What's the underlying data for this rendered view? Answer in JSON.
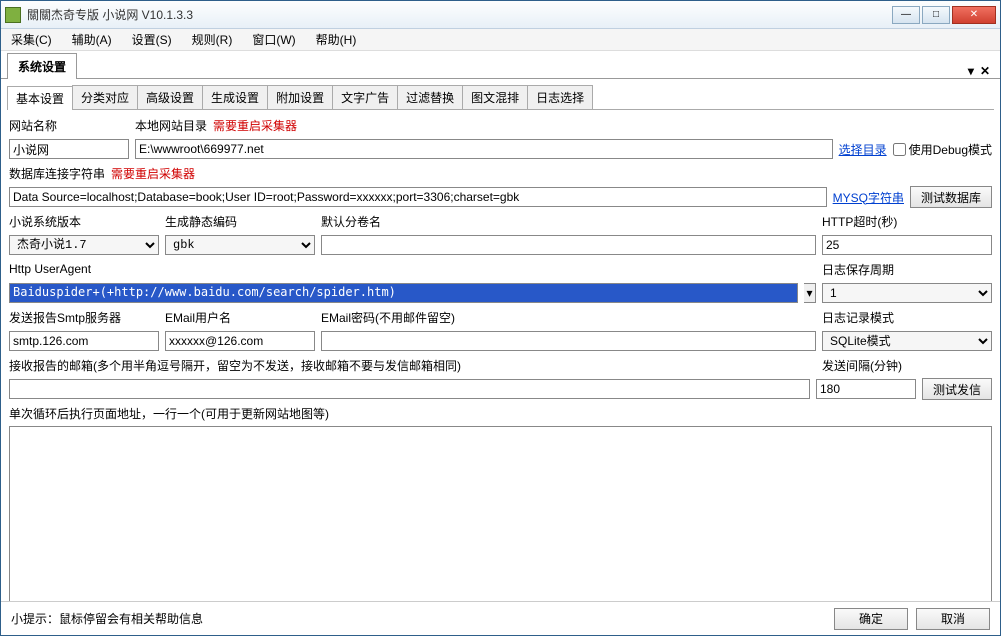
{
  "window": {
    "title": "關關杰奇专版 小说网 V10.1.3.3"
  },
  "menu": {
    "items": [
      "采集(C)",
      "辅助(A)",
      "设置(S)",
      "规则(R)",
      "窗口(W)",
      "帮助(H)"
    ]
  },
  "mainTab": {
    "label": "系统设置"
  },
  "subtabs": [
    "基本设置",
    "分类对应",
    "高级设置",
    "生成设置",
    "附加设置",
    "文字广告",
    "过滤替换",
    "图文混排",
    "日志选择"
  ],
  "labels": {
    "siteName": "网站名称",
    "localDir": "本地网站目录",
    "restart1": "需要重启采集器",
    "dbConn": "数据库连接字符串",
    "restart2": "需要重启采集器",
    "sysVer": "小说系统版本",
    "genEnc": "生成静态编码",
    "defVol": "默认分卷名",
    "httpTimeout": "HTTP超时(秒)",
    "userAgent": "Http UserAgent",
    "logKeep": "日志保存周期",
    "smtp": "发送报告Smtp服务器",
    "emailUser": "EMail用户名",
    "emailPass": "EMail密码(不用邮件留空)",
    "logMode": "日志记录模式",
    "recvMail": "接收报告的邮箱(多个用半角逗号隔开，留空为不发送，接收邮箱不要与发信邮箱相同)",
    "sendInterval": "发送间隔(分钟)",
    "loopUrl": "单次循环后执行页面地址，一行一个(可用于更新网站地图等)"
  },
  "values": {
    "siteName": "小说网",
    "localDir": "E:\\wwwroot\\669977.net",
    "dbConn": "Data Source=localhost;Database=book;User ID=root;Password=xxxxxx;port=3306;charset=gbk",
    "sysVer": "杰奇小说1.7",
    "genEnc": "gbk",
    "defVol": "",
    "httpTimeout": "25",
    "userAgent": "Baiduspider+(+http://www.baidu.com/search/spider.htm)",
    "logKeep": "1",
    "smtp": "smtp.126.com",
    "emailUser": "xxxxxx@126.com",
    "emailPass": "",
    "logMode": "SQLite模式",
    "recvMail": "",
    "sendInterval": "180",
    "loopUrl": ""
  },
  "buttons": {
    "selectDir": "选择目录",
    "useDebug": "使用Debug模式",
    "mysqlStr": "MYSQ字符串",
    "testDb": "测试数据库",
    "testSend": "测试发信",
    "ok": "确定",
    "cancel": "取消"
  },
  "hint": "小提示：鼠标停留会有相关帮助信息"
}
